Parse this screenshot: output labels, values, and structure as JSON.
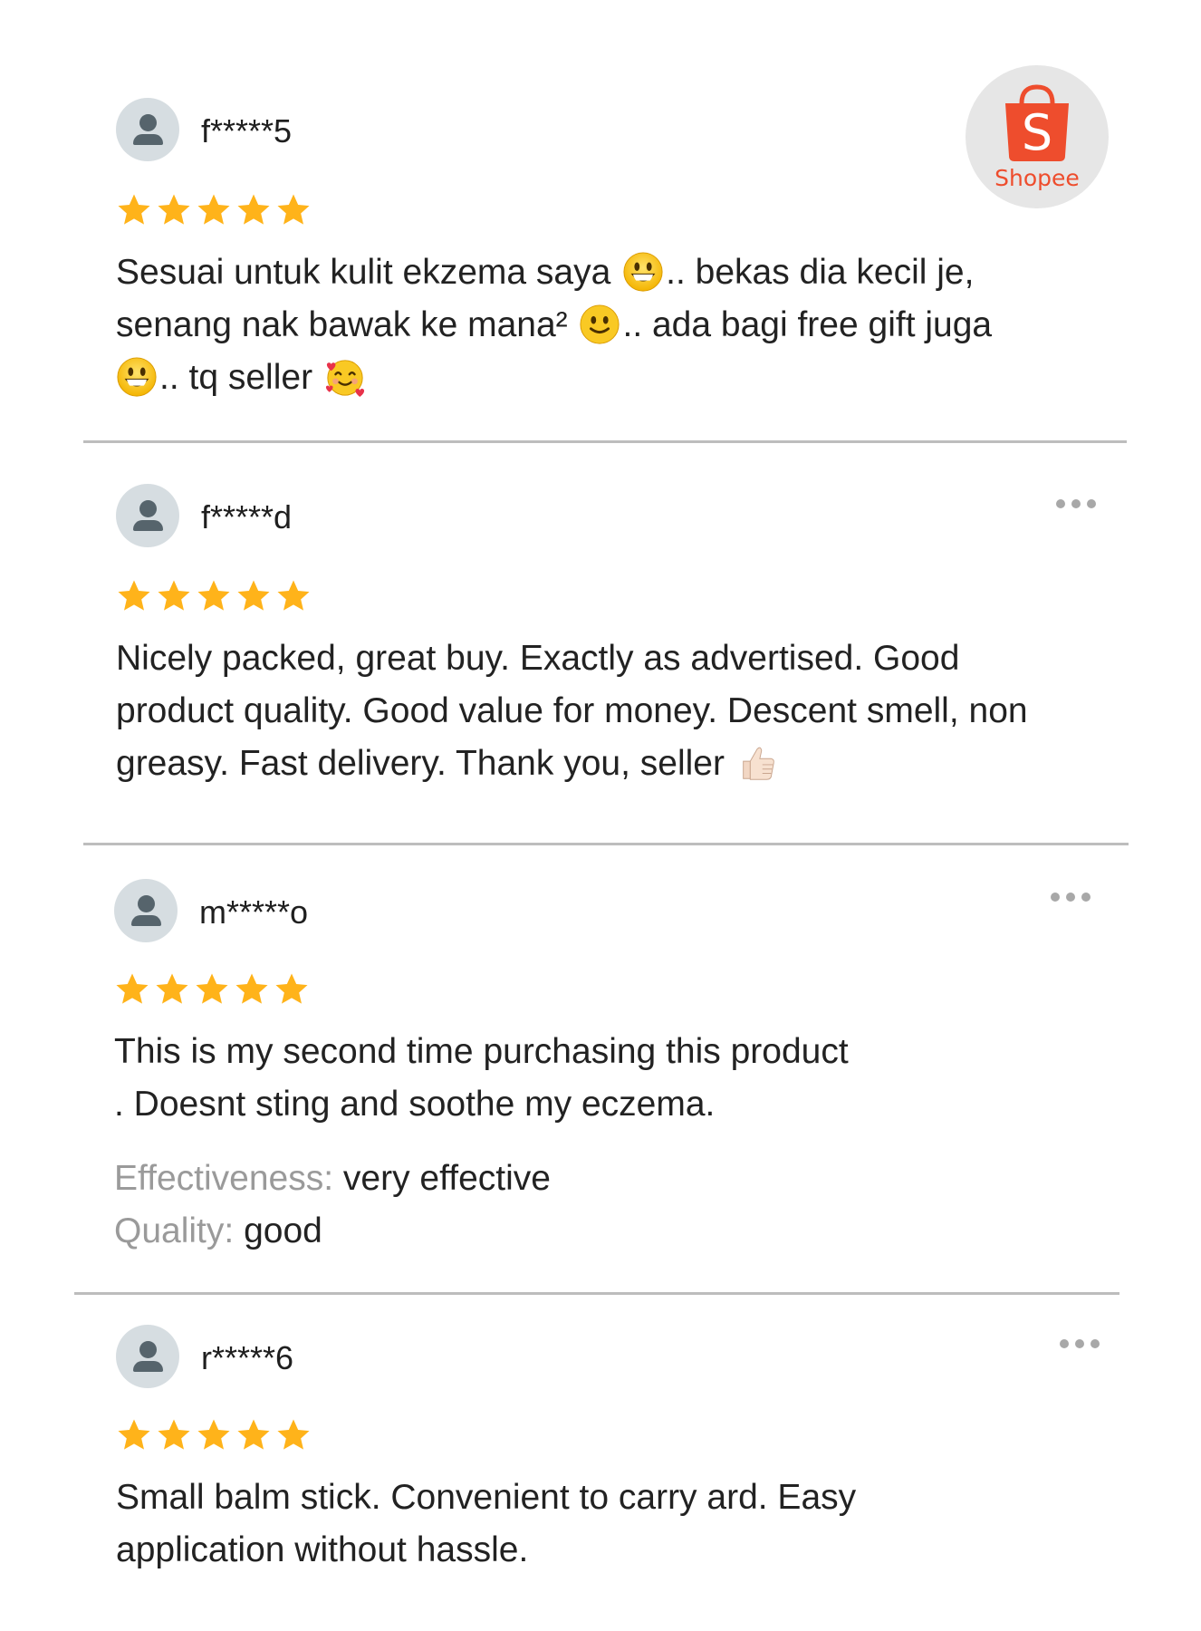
{
  "brand": {
    "name": "Shopee",
    "letter": "S",
    "color": "#ee4d2d"
  },
  "colors": {
    "star": "#ffb31a",
    "divider": "#bdbdbd",
    "muted": "#9a9a9a"
  },
  "reviews": [
    {
      "username": "f*****5",
      "rating": 5,
      "segments": [
        "Sesuai untuk kulit ekzema saya ",
        ".. bekas dia kecil je, senang nak bawak ke mana² ",
        ".. ada bagi free gift juga ",
        ".. tq seller "
      ],
      "emoji_icons": [
        "grinning-face-icon",
        "slightly-smiling-face-icon",
        "grinning-face-icon",
        "smiling-face-with-hearts-icon"
      ]
    },
    {
      "username": "f*****d",
      "rating": 5,
      "text": "Nicely packed, great buy. Exactly as advertised. Good product quality. Good value for money. Descent smell, non greasy. Fast delivery. Thank you, seller ",
      "emoji_icons": [
        "thumbs-up-icon"
      ],
      "more_icon": "more-options-icon"
    },
    {
      "username": "m*****o",
      "rating": 5,
      "text_line1": "This is my second time purchasing this product",
      "text_line2": ". Doesnt sting and soothe my eczema.",
      "attributes": [
        {
          "label": "Effectiveness:",
          "value": "very effective"
        },
        {
          "label": "Quality:",
          "value": "good"
        }
      ],
      "more_icon": "more-options-icon"
    },
    {
      "username": "r*****6",
      "rating": 5,
      "text_line1": "Small balm stick. Convenient to carry ard. Easy",
      "text_line2": "application without hassle.",
      "more_icon": "more-options-icon"
    }
  ]
}
